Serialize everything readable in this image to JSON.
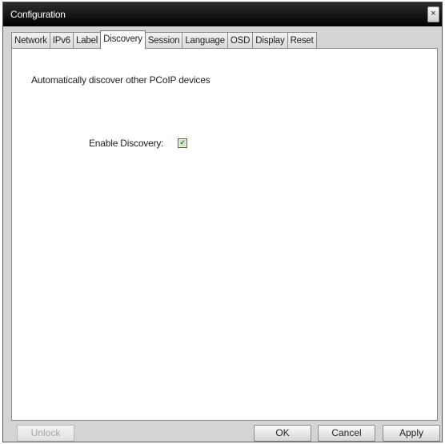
{
  "window": {
    "title": "Configuration",
    "close_glyph": "×"
  },
  "tabs": [
    {
      "label": "Network",
      "active": false
    },
    {
      "label": "IPv6",
      "active": false
    },
    {
      "label": "Label",
      "active": false
    },
    {
      "label": "Discovery",
      "active": true
    },
    {
      "label": "Session",
      "active": false
    },
    {
      "label": "Language",
      "active": false
    },
    {
      "label": "OSD",
      "active": false
    },
    {
      "label": "Display",
      "active": false
    },
    {
      "label": "Reset",
      "active": false
    }
  ],
  "discovery": {
    "description": "Automatically discover other PCoIP devices",
    "enable_label": "Enable Discovery:",
    "enable_checked": true,
    "check_glyph": "✓"
  },
  "buttons": {
    "unlock": "Unlock",
    "ok": "OK",
    "cancel": "Cancel",
    "apply": "Apply"
  }
}
